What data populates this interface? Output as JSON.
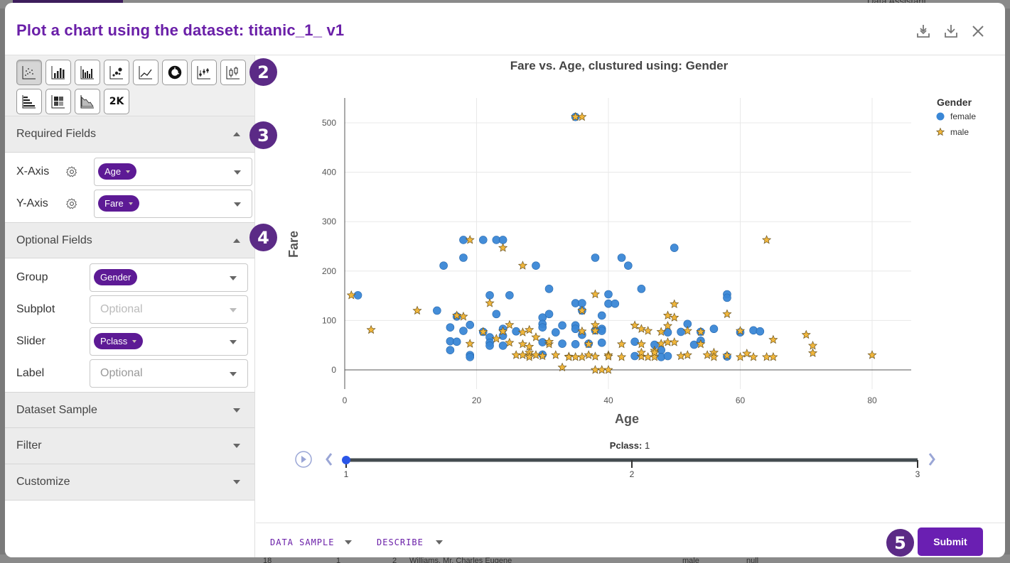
{
  "modal": {
    "title": "Plot a chart using the dataset: titanic_1_ v1",
    "header_icons": [
      "download-all-icon",
      "download-icon",
      "close-icon"
    ]
  },
  "background": {
    "assistant_label": "Data Assistant",
    "row": [
      "18",
      "1",
      "2",
      "Williams, Mr. Charles Eugene",
      "male",
      "null"
    ]
  },
  "chart_types": {
    "row1": [
      "scatter",
      "bar",
      "grouped-bar",
      "bubble",
      "line",
      "donut",
      "dot-range",
      "box"
    ],
    "row2": [
      "horizontal-bar",
      "heatmap",
      "area",
      "kpi"
    ],
    "selected": "scatter",
    "kpi_label": "2K"
  },
  "badges": [
    "2",
    "3",
    "4",
    "5"
  ],
  "required": {
    "title": "Required Fields",
    "fields": [
      {
        "label": "X-Axis",
        "value": "Age"
      },
      {
        "label": "Y-Axis",
        "value": "Fare"
      }
    ]
  },
  "optional": {
    "title": "Optional Fields",
    "fields": [
      {
        "label": "Group",
        "value": "Gender",
        "placeholder": ""
      },
      {
        "label": "Subplot",
        "value": "",
        "placeholder": "Optional"
      },
      {
        "label": "Slider",
        "value": "Pclass",
        "placeholder": ""
      },
      {
        "label": "Label",
        "value": "",
        "placeholder": "Optional"
      }
    ]
  },
  "collapsed_sections": [
    "Dataset Sample",
    "Filter",
    "Customize"
  ],
  "footer": {
    "data_sample": "DATA SAMPLE",
    "describe": "DESCRIBE",
    "submit": "Submit"
  },
  "colors": {
    "accent": "#6a1fa8",
    "female": "#3a87d6",
    "male": "#f0b63c"
  },
  "chart_data": {
    "type": "scatter",
    "title": "Fare vs. Age, clustured using: Gender",
    "xlabel": "Age",
    "ylabel": "Fare",
    "xlim": [
      0,
      86
    ],
    "ylim": [
      -60,
      550
    ],
    "xticks": [
      0,
      20,
      40,
      60,
      80
    ],
    "yticks": [
      0,
      100,
      200,
      300,
      400,
      500
    ],
    "grid": true,
    "legend": {
      "title": "Gender",
      "position": "top-right"
    },
    "slider": {
      "label": "Pclass",
      "value": 1,
      "steps": [
        1,
        2,
        3
      ]
    },
    "series": [
      {
        "name": "female",
        "marker": "circle",
        "points": [
          [
            2,
            151
          ],
          [
            14,
            120
          ],
          [
            15,
            211
          ],
          [
            16,
            86
          ],
          [
            16,
            58
          ],
          [
            16,
            40
          ],
          [
            17,
            57
          ],
          [
            17,
            108
          ],
          [
            18,
            79
          ],
          [
            18,
            227
          ],
          [
            18,
            263
          ],
          [
            19,
            91
          ],
          [
            19,
            30
          ],
          [
            19,
            26
          ],
          [
            21,
            263
          ],
          [
            21,
            77
          ],
          [
            22,
            151
          ],
          [
            22,
            66
          ],
          [
            22,
            55
          ],
          [
            22,
            49
          ],
          [
            23,
            113
          ],
          [
            23,
            263
          ],
          [
            24,
            263
          ],
          [
            24,
            83
          ],
          [
            24,
            69
          ],
          [
            24,
            49
          ],
          [
            25,
            151
          ],
          [
            26,
            78
          ],
          [
            29,
            211
          ],
          [
            30,
            106
          ],
          [
            30,
            93
          ],
          [
            30,
            86
          ],
          [
            30,
            56
          ],
          [
            30,
            31
          ],
          [
            31,
            164
          ],
          [
            31,
            113
          ],
          [
            32,
            76
          ],
          [
            33,
            90
          ],
          [
            33,
            53
          ],
          [
            35,
            512
          ],
          [
            35,
            135
          ],
          [
            35,
            90
          ],
          [
            35,
            83
          ],
          [
            35,
            52
          ],
          [
            36,
            135
          ],
          [
            36,
            120
          ],
          [
            36,
            71
          ],
          [
            37,
            53
          ],
          [
            38,
            227
          ],
          [
            38,
            80
          ],
          [
            39,
            110
          ],
          [
            39,
            83
          ],
          [
            39,
            79
          ],
          [
            39,
            55
          ],
          [
            40,
            153
          ],
          [
            40,
            134
          ],
          [
            41,
            134
          ],
          [
            42,
            227
          ],
          [
            43,
            211
          ],
          [
            44,
            57
          ],
          [
            44,
            28
          ],
          [
            45,
            164
          ],
          [
            47,
            51
          ],
          [
            48,
            40
          ],
          [
            48,
            26
          ],
          [
            49,
            28
          ],
          [
            49,
            76
          ],
          [
            50,
            247
          ],
          [
            51,
            77
          ],
          [
            52,
            93
          ],
          [
            53,
            51
          ],
          [
            54,
            77
          ],
          [
            54,
            59
          ],
          [
            56,
            83
          ],
          [
            58,
            153
          ],
          [
            58,
            146
          ],
          [
            58,
            27
          ],
          [
            60,
            76
          ],
          [
            62,
            80
          ],
          [
            63,
            78
          ]
        ]
      },
      {
        "name": "male",
        "marker": "star",
        "points": [
          [
            1,
            151
          ],
          [
            4,
            81
          ],
          [
            11,
            120
          ],
          [
            17,
            110
          ],
          [
            18,
            108
          ],
          [
            19,
            263
          ],
          [
            19,
            53
          ],
          [
            21,
            77
          ],
          [
            22,
            135
          ],
          [
            23,
            63
          ],
          [
            24,
            247
          ],
          [
            24,
            78
          ],
          [
            25,
            55
          ],
          [
            25,
            91
          ],
          [
            26,
            30
          ],
          [
            27,
            30
          ],
          [
            27,
            52
          ],
          [
            27,
            211
          ],
          [
            27,
            76
          ],
          [
            28,
            81
          ],
          [
            28,
            30
          ],
          [
            28,
            35
          ],
          [
            28,
            47
          ],
          [
            28,
            26
          ],
          [
            29,
            66
          ],
          [
            29,
            30
          ],
          [
            30,
            28
          ],
          [
            31,
            52
          ],
          [
            31,
            57
          ],
          [
            32,
            30
          ],
          [
            33,
            5
          ],
          [
            34,
            27
          ],
          [
            34,
            26
          ],
          [
            35,
            512
          ],
          [
            35,
            26
          ],
          [
            36,
            512
          ],
          [
            36,
            120
          ],
          [
            36,
            78
          ],
          [
            36,
            26
          ],
          [
            37,
            52
          ],
          [
            37,
            30
          ],
          [
            38,
            153
          ],
          [
            38,
            91
          ],
          [
            38,
            79
          ],
          [
            38,
            0
          ],
          [
            38,
            27
          ],
          [
            39,
            0
          ],
          [
            40,
            0
          ],
          [
            40,
            30
          ],
          [
            40,
            27
          ],
          [
            42,
            52
          ],
          [
            42,
            26
          ],
          [
            44,
            90
          ],
          [
            45,
            83
          ],
          [
            45,
            52
          ],
          [
            45,
            27
          ],
          [
            45,
            35
          ],
          [
            46,
            79
          ],
          [
            46,
            26
          ],
          [
            47,
            39
          ],
          [
            47,
            26
          ],
          [
            47,
            35
          ],
          [
            48,
            77
          ],
          [
            48,
            53
          ],
          [
            49,
            110
          ],
          [
            49,
            89
          ],
          [
            49,
            56
          ],
          [
            50,
            133
          ],
          [
            50,
            106
          ],
          [
            50,
            56
          ],
          [
            51,
            28
          ],
          [
            52,
            30
          ],
          [
            52,
            79
          ],
          [
            54,
            77
          ],
          [
            54,
            52
          ],
          [
            55,
            30
          ],
          [
            56,
            35
          ],
          [
            56,
            26
          ],
          [
            58,
            113
          ],
          [
            58,
            29
          ],
          [
            60,
            79
          ],
          [
            60,
            26
          ],
          [
            61,
            33
          ],
          [
            62,
            26
          ],
          [
            64,
            263
          ],
          [
            64,
            26
          ],
          [
            65,
            61
          ],
          [
            65,
            26
          ],
          [
            70,
            71
          ],
          [
            71,
            49
          ],
          [
            71,
            34
          ],
          [
            80,
            30
          ]
        ]
      }
    ]
  }
}
